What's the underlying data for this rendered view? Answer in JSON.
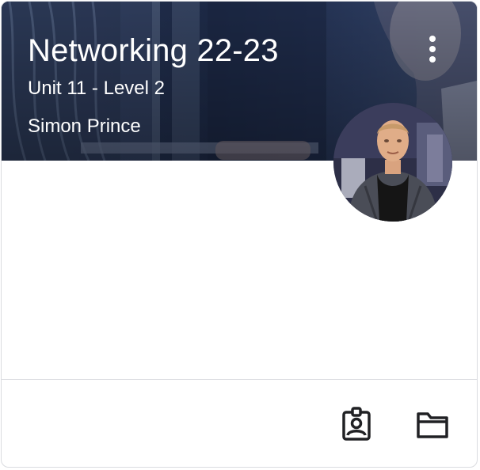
{
  "course_card": {
    "title": "Networking 22-23",
    "section": "Unit 11 - Level 2",
    "teacher": "Simon Prince"
  },
  "icons": {
    "more": "more-vert-icon",
    "gradebook": "assignment-ind-icon",
    "folder": "folder-icon"
  },
  "colors": {
    "banner_overlay": "#1f2d4d",
    "text_on_banner": "#ffffff",
    "icon": "#202124",
    "divider": "#dadce0"
  }
}
